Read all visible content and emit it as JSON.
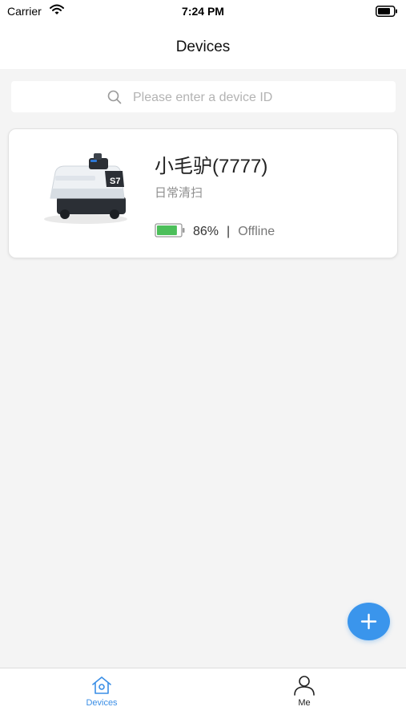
{
  "status_bar": {
    "carrier": "Carrier",
    "time": "7:24 PM",
    "wifi_icon": "wifi-icon",
    "battery_icon": "battery-icon"
  },
  "nav": {
    "title": "Devices"
  },
  "search": {
    "placeholder": "Please enter a device ID",
    "value": "",
    "icon": "search-icon"
  },
  "devices": [
    {
      "name": "小毛驴(7777)",
      "description": "日常清扫",
      "battery": "86%",
      "battery_level": 0.86,
      "separator": "|",
      "status": "Offline",
      "image": "cleaning-robot-image"
    }
  ],
  "fab": {
    "icon": "plus-icon"
  },
  "tab_bar": {
    "tabs": [
      {
        "label": "Devices",
        "icon": "home-icon",
        "active": true
      },
      {
        "label": "Me",
        "icon": "user-icon",
        "active": false
      }
    ]
  },
  "colors": {
    "accent": "#3a95ec",
    "tab_active": "#3a8ee6",
    "battery_fill": "#4cbf5a",
    "background": "#f4f4f4"
  }
}
